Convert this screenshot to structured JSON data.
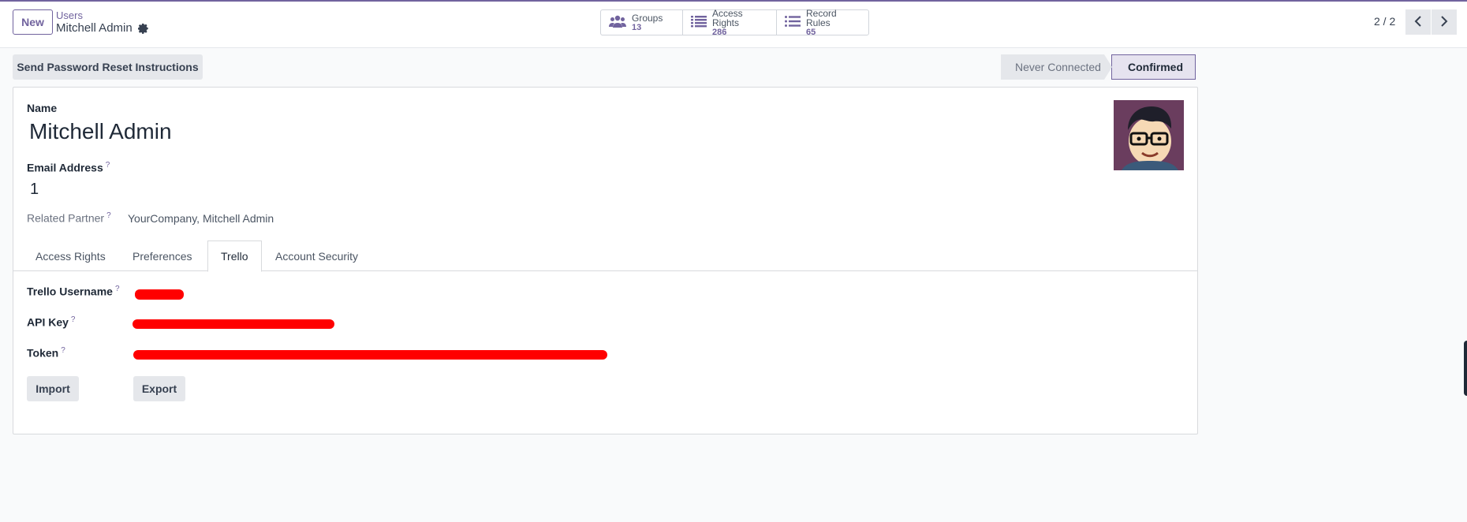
{
  "control_panel": {
    "new_label": "New",
    "breadcrumb_parent": "Users",
    "breadcrumb_current": "Mitchell Admin",
    "smart_buttons": [
      {
        "label": "Groups",
        "count": "13",
        "icon": "users-icon"
      },
      {
        "label": "Access Rights",
        "count": "286",
        "icon": "list-icon"
      },
      {
        "label": "Record Rules",
        "count": "65",
        "icon": "list-icon"
      }
    ],
    "pager": "2 / 2"
  },
  "header_actions": {
    "reset_password_label": "Send Password Reset Instructions"
  },
  "status_bar": {
    "stages": [
      "Never Connected",
      "Confirmed"
    ],
    "active": "Confirmed"
  },
  "form": {
    "name_label": "Name",
    "name_value": "Mitchell Admin",
    "email_label": "Email Address",
    "email_value": "1",
    "partner_label": "Related Partner",
    "partner_value": "YourCompany, Mitchell Admin",
    "help_mark": "?"
  },
  "tabs": [
    {
      "label": "Access Rights"
    },
    {
      "label": "Preferences"
    },
    {
      "label": "Trello"
    },
    {
      "label": "Account Security"
    }
  ],
  "active_tab": "Trello",
  "trello": {
    "username_label": "Trello Username",
    "api_key_label": "API Key",
    "token_label": "Token",
    "import_label": "Import",
    "export_label": "Export"
  },
  "colors": {
    "accent": "#71639e",
    "redaction": "#ff0000"
  }
}
